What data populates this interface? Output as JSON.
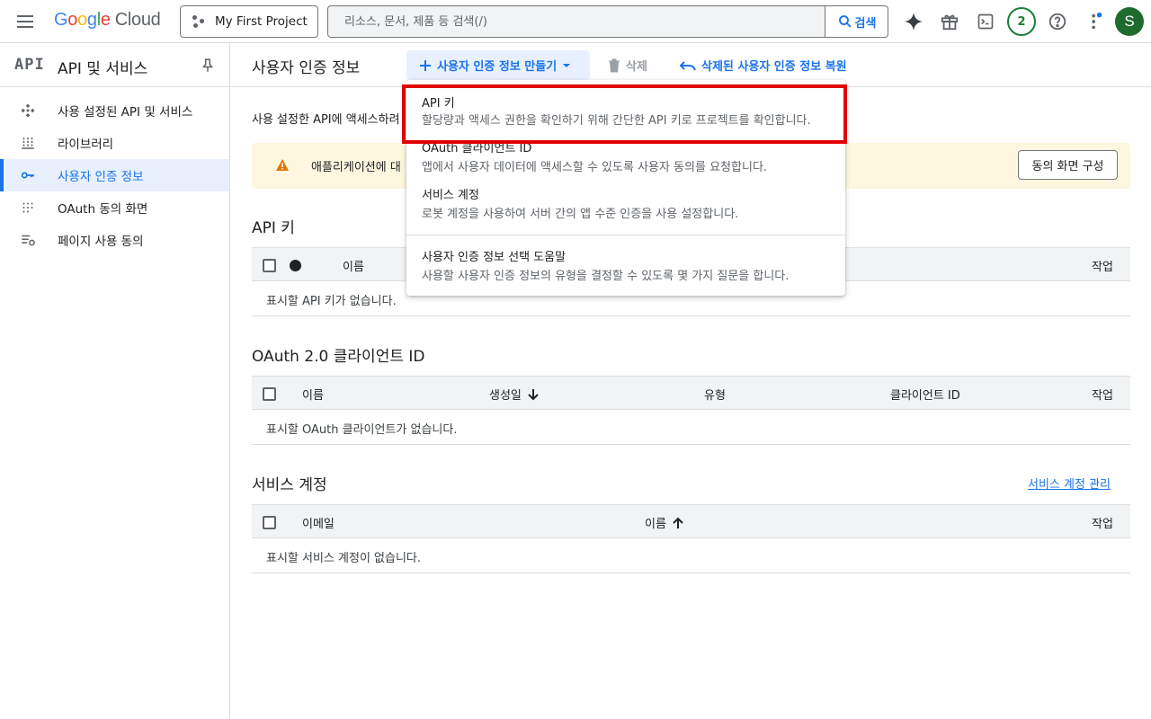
{
  "topbar": {
    "logo_google": [
      "G",
      "o",
      "o",
      "g",
      "l",
      "e"
    ],
    "logo_cloud": "Cloud",
    "project": "My First Project",
    "search_placeholder": "리소스, 문서, 제품 등 검색(/)",
    "search_button": "검색",
    "notification_count": "2",
    "avatar_initial": "S"
  },
  "sidebar": {
    "logo": "API",
    "title": "API 및 서비스",
    "items": [
      {
        "label": "사용 설정된 API 및 서비스",
        "icon": "diamond-arrows-icon"
      },
      {
        "label": "라이브러리",
        "icon": "library-icon"
      },
      {
        "label": "사용자 인증 정보",
        "icon": "key-icon",
        "active": true
      },
      {
        "label": "OAuth 동의 화면",
        "icon": "dots-grid-icon"
      },
      {
        "label": "페이지 사용 동의",
        "icon": "settings-list-icon"
      }
    ]
  },
  "main": {
    "title": "사용자 인증 정보",
    "create_button": "사용자 인증 정보 만들기",
    "delete_button": "삭제",
    "restore_button": "삭제된 사용자 인증 정보 복원",
    "intro": "사용 설정한 API에 액세스하려",
    "banner": {
      "message": "애플리케이션에 대",
      "button": "동의 화면 구성"
    },
    "api_keys": {
      "title": "API 키",
      "columns": [
        "이름",
        "작업"
      ],
      "empty": "표시할 API 키가 없습니다."
    },
    "oauth": {
      "title": "OAuth 2.0 클라이언트 ID",
      "columns": [
        "이름",
        "생성일",
        "유형",
        "클라이언트 ID",
        "작업"
      ],
      "empty": "표시할 OAuth 클라이언트가 없습니다."
    },
    "service_accounts": {
      "title": "서비스 계정",
      "manage_link": "서비스 계정 관리",
      "columns": [
        "이메일",
        "이름",
        "작업"
      ],
      "empty": "표시할 서비스 계정이 없습니다."
    }
  },
  "dropdown": {
    "items": [
      {
        "title": "API 키",
        "desc": "할당량과 액세스 권한을 확인하기 위해 간단한 API 키로 프로젝트를 확인합니다."
      },
      {
        "title": "OAuth 클라이언트 ID",
        "desc": "앱에서 사용자 데이터에 액세스할 수 있도록 사용자 동의를 요청합니다."
      },
      {
        "title": "서비스 계정",
        "desc": "로봇 계정을 사용하여 서버 간의 앱 수준 인증을 사용 설정합니다."
      },
      {
        "title": "사용자 인증 정보 선택 도움말",
        "desc": "사용할 사용자 인증 정보의 유형을 결정할 수 있도록 몇 가지 질문을 합니다."
      }
    ]
  },
  "colors": {
    "accent": "#1a73e8",
    "highlight": "#e00000",
    "banner_bg": "#fef7e0",
    "warning": "#e37400"
  }
}
